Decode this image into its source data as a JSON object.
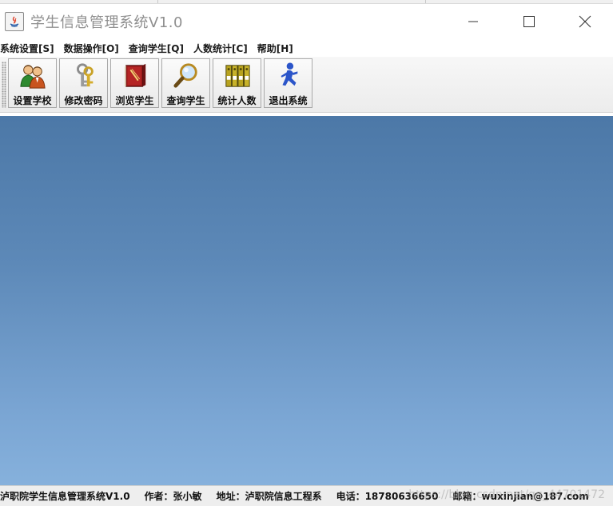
{
  "window": {
    "title": "学生信息管理系统V1.0"
  },
  "menu": {
    "items": [
      {
        "label": "系统设置[S]"
      },
      {
        "label": "数据操作[O]"
      },
      {
        "label": "查询学生[Q]"
      },
      {
        "label": "人数统计[C]"
      },
      {
        "label": "帮助[H]"
      }
    ]
  },
  "toolbar": {
    "buttons": [
      {
        "label": "设置学校",
        "icon": "users-icon"
      },
      {
        "label": "修改密码",
        "icon": "keys-icon"
      },
      {
        "label": "浏览学生",
        "icon": "book-icon"
      },
      {
        "label": "查询学生",
        "icon": "magnifier-icon"
      },
      {
        "label": "统计人数",
        "icon": "binders-icon"
      },
      {
        "label": "退出系统",
        "icon": "running-man-icon"
      }
    ]
  },
  "status": {
    "items": [
      {
        "text": "泸职院学生信息管理系统V1.0"
      },
      {
        "text": "作者：张小敏"
      },
      {
        "text": "地址：泸职院信息工程系"
      },
      {
        "text": "电话：18780636650"
      },
      {
        "text": "邮箱：wuxinjian@187.com"
      }
    ],
    "watermark": "https://blog.csdn.net/qq_44701472"
  },
  "colors": {
    "desktop_top": "#4c78a7",
    "desktop_bottom": "#86b1dc",
    "title_text": "#8f8f8f"
  }
}
